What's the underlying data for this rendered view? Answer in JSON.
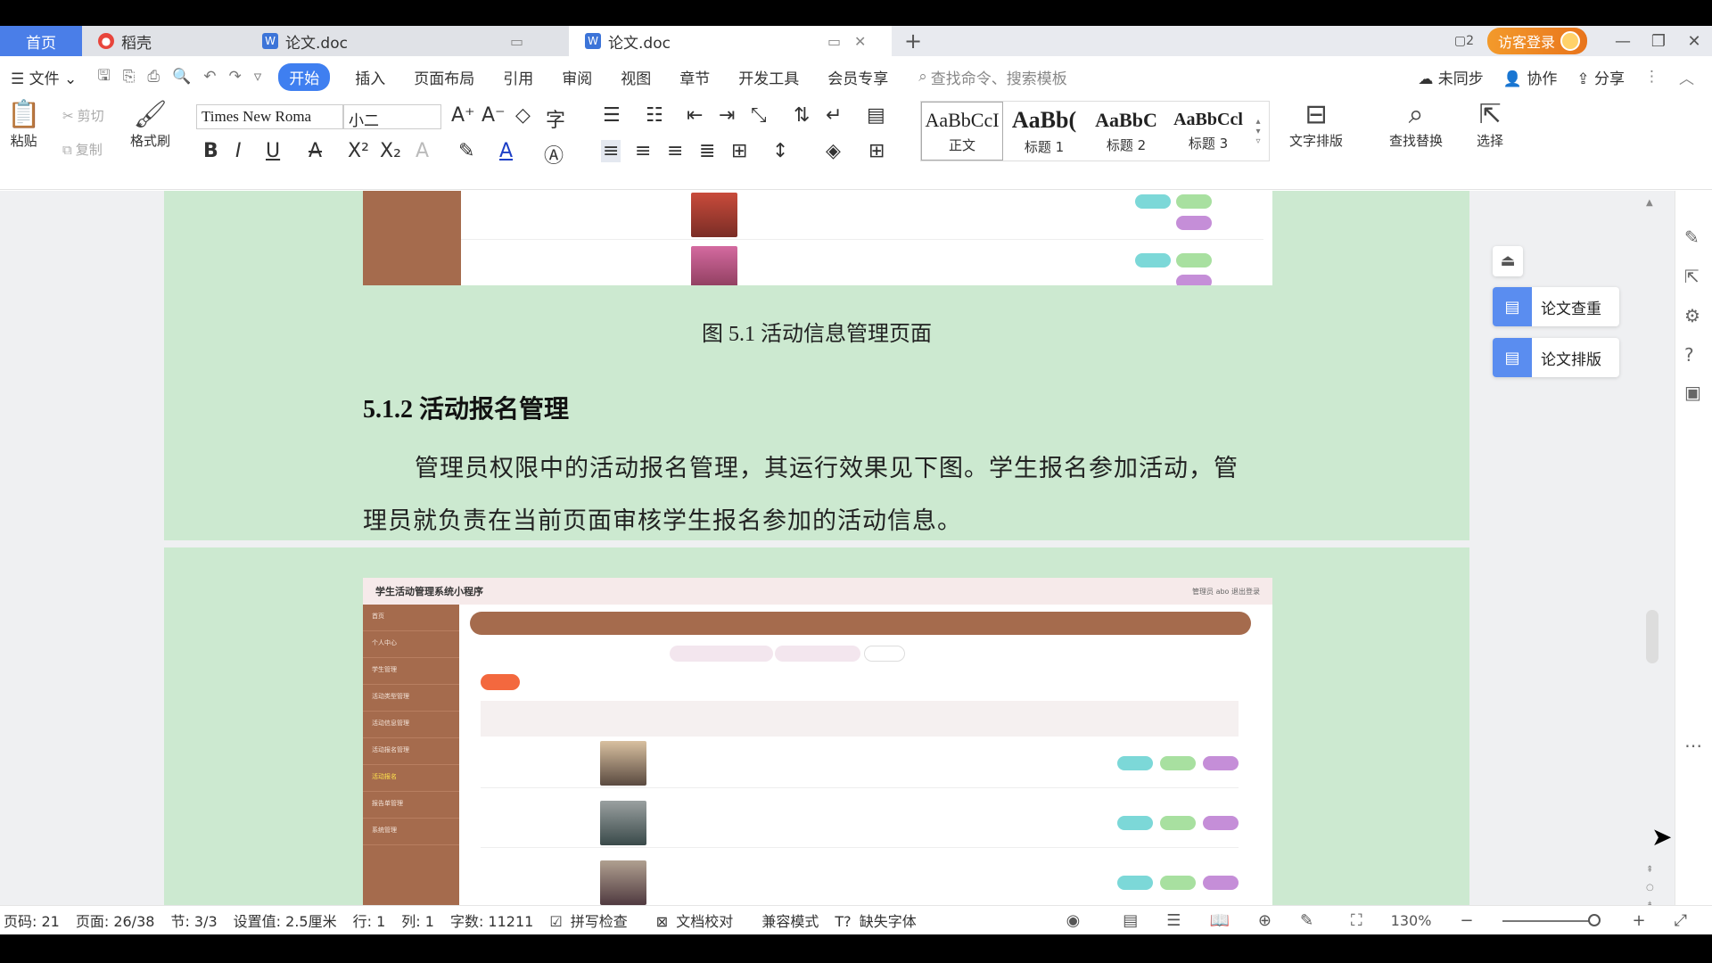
{
  "titlebar": {
    "home_tab": "首页",
    "tabs": [
      {
        "label": "稻壳"
      },
      {
        "label": "论文.doc"
      },
      {
        "label": "论文.doc"
      }
    ],
    "login_label": "访客登录"
  },
  "menubar": {
    "file_label": "文件",
    "tabs": [
      "开始",
      "插入",
      "页面布局",
      "引用",
      "审阅",
      "视图",
      "章节",
      "开发工具",
      "会员专享"
    ],
    "search_placeholder": "查找命令、搜索模板",
    "right": {
      "sync": "未同步",
      "collab": "协作",
      "share": "分享"
    }
  },
  "ribbon": {
    "paste": "粘贴",
    "cut": "剪切",
    "copy": "复制",
    "format_painter": "格式刷",
    "font_name": "Times New Roma",
    "font_size": "小二",
    "styles": [
      {
        "preview": "AaBbCcI",
        "label": "正文"
      },
      {
        "preview": "AaBb(",
        "label": "标题 1"
      },
      {
        "preview": "AaBbC",
        "label": "标题 2"
      },
      {
        "preview": "AaBbCcl",
        "label": "标题 3"
      }
    ],
    "text_layout": "文字排版",
    "find_replace": "查找替换",
    "select": "选择"
  },
  "document": {
    "figure_caption": "图 5.1  活动信息管理页面",
    "section_heading": "5.1.2  活动报名管理",
    "paragraph_line1": "管理员权限中的活动报名管理，其运行效果见下图。学生报名参加活动，管",
    "paragraph_line2": "理员就负责在当前页面审核学生报名参加的活动信息。",
    "mini_app": {
      "title": "学生活动管理系统小程序",
      "header_right": "管理员 abo   退出登录",
      "sidebar": [
        "首页",
        "个人中心",
        "学生管理",
        "活动类型管理",
        "活动信息管理",
        "活动报名管理",
        "活动报名",
        "报告单管理",
        "系统管理"
      ]
    }
  },
  "side_panel": {
    "check": "论文查重",
    "format": "论文排版"
  },
  "statusbar": {
    "page_code": "页码: 21",
    "page": "页面: 26/38",
    "section": "节: 3/3",
    "setting": "设置值: 2.5厘米",
    "row": "行: 1",
    "col": "列: 1",
    "words": "字数: 11211",
    "spell": "拼写检查",
    "proof": "文档校对",
    "compat": "兼容模式",
    "missing_font": "缺失字体",
    "zoom": "130%"
  }
}
